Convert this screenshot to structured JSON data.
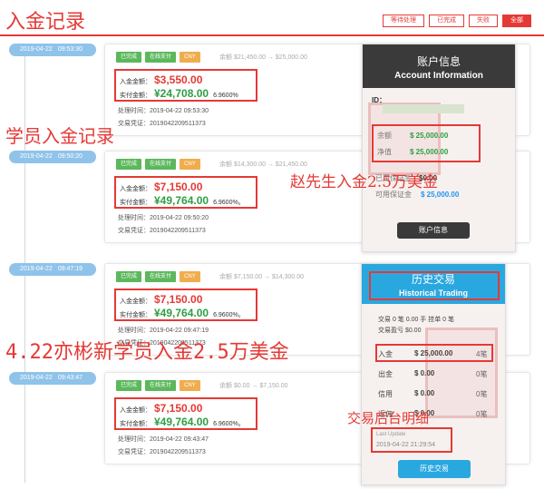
{
  "header": {
    "title": "入金记录",
    "tabs": [
      "等待处理",
      "已完成",
      "失败",
      "全部"
    ],
    "active_tab": 3
  },
  "records": [
    {
      "date": "2019-04-22",
      "time": "09:53:30",
      "badges": [
        "已完成",
        "在线支付",
        "CNY"
      ],
      "balance_change": "余额 $21,450.00 → $25,000.00",
      "deposit_label": "入金金额：",
      "deposit": "$3,550.00",
      "paid_label": "实付金额：",
      "paid": "¥24,708.00",
      "rate": "6.9600%",
      "process_time": "处理时间：2019-04-22 09:53:30",
      "voucher": "交易凭证：2019042209511373"
    },
    {
      "date": "2019-04-22",
      "time": "09:50:20",
      "badges": [
        "已完成",
        "在线支付",
        "CNY"
      ],
      "balance_change": "余额 $14,300.00 → $21,450.00",
      "deposit_label": "入金金额：",
      "deposit": "$7,150.00",
      "paid_label": "实付金额：",
      "paid": "¥49,764.00",
      "rate": "6.9600%。",
      "process_time": "处理时间：2019-04-22 09:50:20",
      "voucher": "交易凭证：2019042209511373"
    },
    {
      "date": "2019-04-22",
      "time": "09:47:19",
      "badges": [
        "已完成",
        "在线支付",
        "CNY"
      ],
      "balance_change": "余额 $7,150.00 → $14,300.00",
      "deposit_label": "入金金额：",
      "deposit": "$7,150.00",
      "paid_label": "实付金额：",
      "paid": "¥49,764.00",
      "rate": "6.9600%。",
      "process_time": "处理时间：2019-04-22 09:47:19",
      "voucher": "交易凭证：2019042209511373"
    },
    {
      "date": "2019-04-22",
      "time": "09:43:47",
      "badges": [
        "已完成",
        "在线支付",
        "CNY"
      ],
      "balance_change": "余额 $0.00 → $7,150.00",
      "deposit_label": "入金金额：",
      "deposit": "$7,150.00",
      "paid_label": "实付金额：",
      "paid": "¥49,764.00",
      "rate": "6.9600%。",
      "process_time": "处理时间：2019-04-22 09:43:47",
      "voucher": "交易凭证：2019042209511373"
    }
  ],
  "account_card": {
    "title_cn": "账户信息",
    "title_en": "Account Information",
    "id_label": "ID：",
    "balance_label": "余额",
    "balance": "$ 25,000.00",
    "equity_label": "净值",
    "equity": "$ 25,000.00",
    "margin_label": "已用保证金",
    "margin": "$0.00",
    "free_margin_label": "可用保证金",
    "free_margin": "$ 25,000.00",
    "button": "账户信息"
  },
  "history_card": {
    "title_cn": "历史交易",
    "title_en": "Historical Trading",
    "trade_count_line": "交易 0 笔 0.00 手  挂单 0 笔",
    "trade_profit_line": "交易盈亏 $0.00",
    "rows": [
      {
        "label": "入金",
        "value": "$ 25,000.00",
        "count": "4笔"
      },
      {
        "label": "出金",
        "value": "$ 0.00",
        "count": "0笔"
      },
      {
        "label": "信用",
        "value": "$ 0.00",
        "count": "0笔"
      },
      {
        "label": "返佣",
        "value": "$ 0.00",
        "count": "0笔"
      }
    ],
    "last_update_label": "Last Update",
    "last_update": "2019-04-22 21:29:54",
    "button": "历史交易"
  },
  "annotations": {
    "student_deposit": "学员入金记录",
    "zhao_deposit": "赵先生入金2.5万美金",
    "new_student": "4.22亦彬新学员入金2.5万美金",
    "backend_detail": "交易后台明细"
  },
  "colors": {
    "brand_red": "#e53935",
    "green": "#2e9e44",
    "blue": "#29a8e0",
    "pill": "#8fc3ea"
  }
}
